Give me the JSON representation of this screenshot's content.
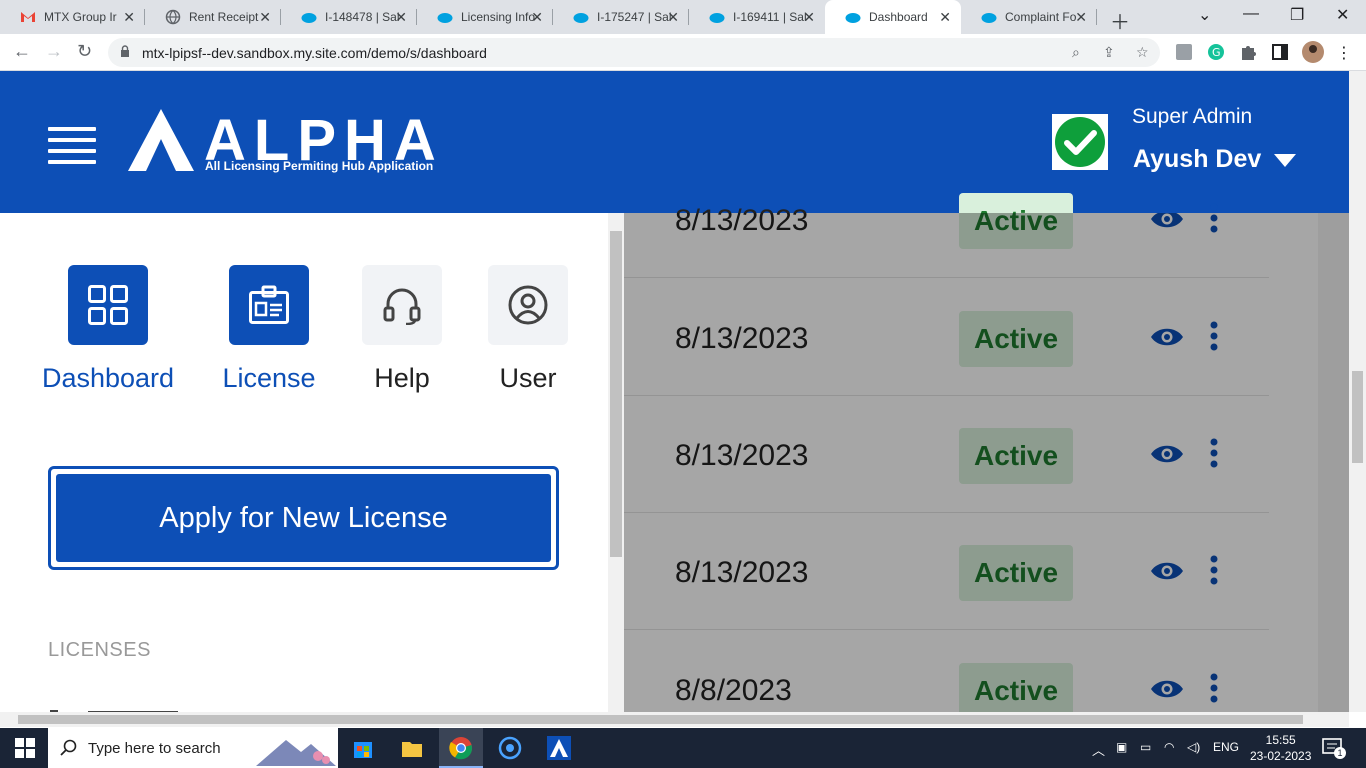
{
  "browser": {
    "tabs": [
      {
        "title": "MTX Group Ir",
        "icon": "gmail-icon"
      },
      {
        "title": "Rent Receipt",
        "icon": "globe-icon"
      },
      {
        "title": "I-148478 | Sal",
        "icon": "salesforce-icon"
      },
      {
        "title": "Licensing Info",
        "icon": "salesforce-icon"
      },
      {
        "title": "I-175247 | Sal",
        "icon": "salesforce-icon"
      },
      {
        "title": "I-169411 | Sal",
        "icon": "salesforce-icon"
      },
      {
        "title": "Dashboard",
        "icon": "salesforce-icon",
        "active": true
      },
      {
        "title": "Complaint Fo",
        "icon": "salesforce-icon"
      }
    ],
    "url": "mtx-lpipsf--dev.sandbox.my.site.com/demo/s/dashboard"
  },
  "header": {
    "brand": "ALPHA",
    "tagline": "All Licensing Permiting Hub Application",
    "role": "Super Admin",
    "user_name": "Ayush Dev"
  },
  "drawer": {
    "quick_actions": [
      {
        "label": "Dashboard",
        "icon": "dashboard-grid-icon"
      },
      {
        "label": "License",
        "icon": "license-badge-icon"
      },
      {
        "label": "Help",
        "icon": "headset-icon"
      },
      {
        "label": "User",
        "icon": "user-circle-icon"
      }
    ],
    "apply_button": "Apply for New License",
    "section_label": "LICENSES"
  },
  "table": {
    "rows": [
      {
        "date": "8/13/2023",
        "status": "Active"
      },
      {
        "date": "8/13/2023",
        "status": "Active"
      },
      {
        "date": "8/13/2023",
        "status": "Active"
      },
      {
        "date": "8/13/2023",
        "status": "Active"
      },
      {
        "date": "8/8/2023",
        "status": "Active"
      }
    ]
  },
  "taskbar": {
    "search_placeholder": "Type here to search",
    "language": "ENG",
    "time": "15:55",
    "date": "23-02-2023",
    "notification_count": "1"
  },
  "colors": {
    "brand_blue": "#0d4fb6",
    "status_green_bg": "#d9f0dc",
    "status_green_text": "#1e7a2e"
  }
}
